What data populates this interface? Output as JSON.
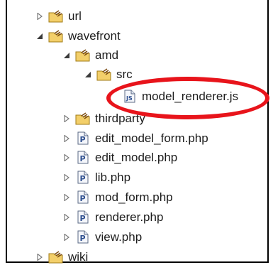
{
  "tree": {
    "items": [
      {
        "id": "url",
        "label": "url",
        "kind": "package-folder",
        "state": "collapsed",
        "depth": 0
      },
      {
        "id": "wavefront",
        "label": "wavefront",
        "kind": "package-folder",
        "state": "expanded",
        "depth": 0
      },
      {
        "id": "amd",
        "label": "amd",
        "kind": "package-folder",
        "state": "expanded",
        "depth": 1
      },
      {
        "id": "src",
        "label": "src",
        "kind": "package-folder",
        "state": "expanded",
        "depth": 2
      },
      {
        "id": "model_renderer",
        "label": "model_renderer.js",
        "kind": "js-file",
        "state": "leaf",
        "depth": 3
      },
      {
        "id": "thirdparty",
        "label": "thirdparty",
        "kind": "package-folder",
        "state": "collapsed",
        "depth": 1
      },
      {
        "id": "edit_model_form",
        "label": "edit_model_form.php",
        "kind": "php-file",
        "state": "collapsed",
        "depth": 1
      },
      {
        "id": "edit_model",
        "label": "edit_model.php",
        "kind": "php-file",
        "state": "collapsed",
        "depth": 1
      },
      {
        "id": "lib",
        "label": "lib.php",
        "kind": "php-file",
        "state": "collapsed",
        "depth": 1
      },
      {
        "id": "mod_form",
        "label": "mod_form.php",
        "kind": "php-file",
        "state": "collapsed",
        "depth": 1
      },
      {
        "id": "renderer",
        "label": "renderer.php",
        "kind": "php-file",
        "state": "collapsed",
        "depth": 1
      },
      {
        "id": "view",
        "label": "view.php",
        "kind": "php-file",
        "state": "collapsed",
        "depth": 1
      },
      {
        "id": "wiki",
        "label": "wiki",
        "kind": "package-folder",
        "state": "collapsed",
        "depth": 0
      }
    ]
  },
  "colors": {
    "highlight": "#e8141b",
    "php_icon": "#2e4f8f",
    "folder": "#e6b640"
  }
}
